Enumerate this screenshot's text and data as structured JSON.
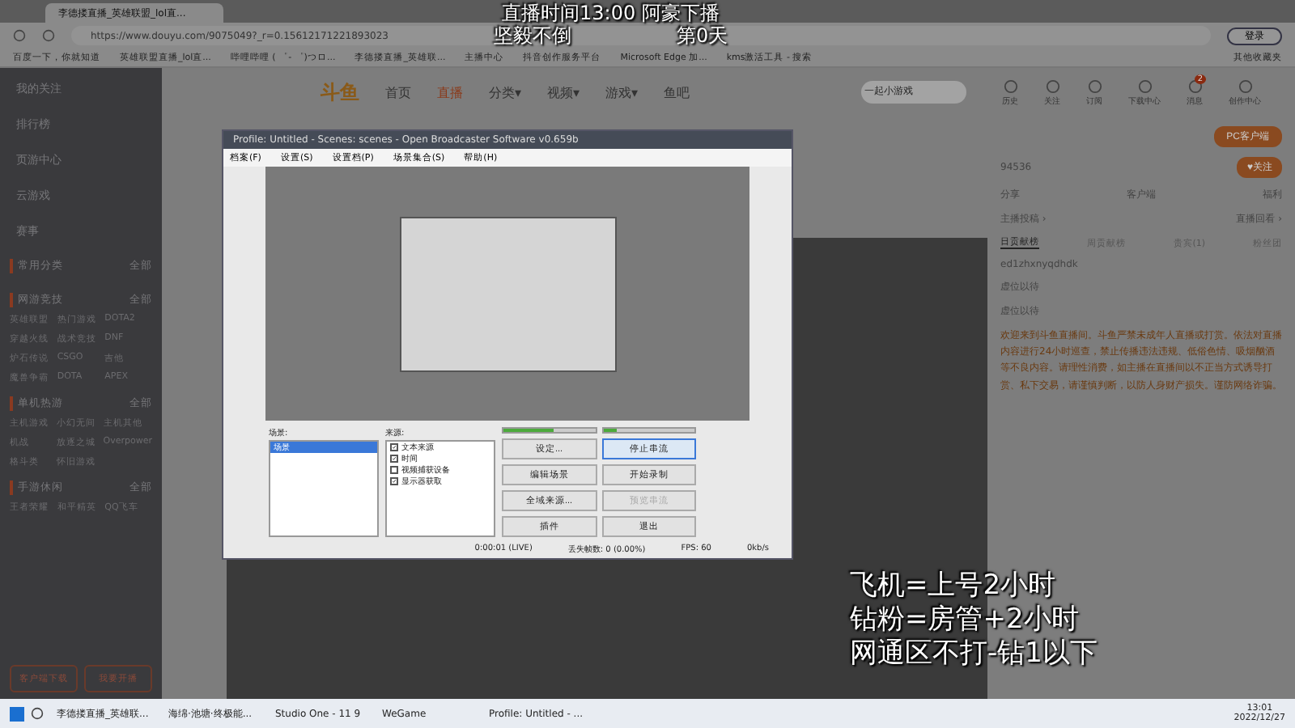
{
  "browser": {
    "tab_title": "李德搂直播_英雄联盟_lol直...",
    "address": "https://www.douyu.com/9075049?_r=0.15612171221893023",
    "login": "登录",
    "bookmarks": [
      "百度一下，你就知道",
      "英雄联盟直播_lol直...",
      "哔哩哔哩 ( ゜- ゜)つロ...",
      "李德搂直播_英雄联...",
      "主播中心",
      "抖音创作服务平台",
      "Microsoft Edge 加...",
      "kms激活工具 - 搜索"
    ],
    "other_bookmarks": "其他收藏夹"
  },
  "site": {
    "logo": "斗鱼",
    "nav": [
      {
        "label": "首页",
        "selected": false
      },
      {
        "label": "直播",
        "selected": true
      },
      {
        "label": "分类▾",
        "selected": false
      },
      {
        "label": "视频▾",
        "selected": false
      },
      {
        "label": "游戏▾",
        "selected": false
      },
      {
        "label": "鱼吧",
        "selected": false
      }
    ],
    "search": {
      "placeholder": "一起小游戏"
    },
    "header_icons": [
      "历史",
      "关注",
      "订阅",
      "下载中心",
      "消息",
      "创作中心"
    ],
    "message_badge": "2"
  },
  "sidebar": {
    "items": [
      "我的关注",
      "排行榜",
      "页游中心",
      "云游戏",
      "赛事"
    ],
    "sections": [
      {
        "title": "常用分类",
        "more": "全部"
      },
      {
        "title": "网游竞技",
        "more": "全部",
        "entries": [
          "英雄联盟",
          "热门游戏",
          "DOTA2",
          "穿越火线",
          "战术竞技",
          "DNF",
          "炉石传说",
          "CSGO",
          "吉他",
          "魔兽争霸",
          "DOTA",
          "APEX"
        ]
      },
      {
        "title": "单机热游",
        "more": "全部",
        "entries": [
          "主机游戏",
          "小幻无间",
          "主机其他",
          "机战",
          "放逐之城",
          "Overpower",
          "格斗类",
          "怀旧游戏"
        ]
      },
      {
        "title": "手游休闲",
        "more": "全部",
        "entries": [
          "王者荣耀",
          "和平精英",
          "QQ飞车"
        ]
      }
    ],
    "buttons": [
      "客户端下载",
      "我要开播"
    ]
  },
  "right_panel": {
    "pc_client": "PC客户端",
    "follow_count": "94536",
    "follow": "♥关注",
    "share": [
      "分享",
      "客户端",
      "福利"
    ],
    "links": [
      "主播投稿 ›",
      "直播回看 ›"
    ],
    "tabs": [
      {
        "label": "日贡献榜",
        "selected": true
      },
      {
        "label": "周贡献榜",
        "selected": false
      },
      {
        "label": "贵宾(1)",
        "selected": false
      },
      {
        "label": "粉丝团",
        "selected": false
      }
    ],
    "ranking": [
      "ed1zhxnyqdhdk",
      "虚位以待",
      "虚位以待"
    ],
    "notice": "欢迎来到斗鱼直播间。斗鱼严禁未成年人直播或打赏。依法对直播内容进行24小时巡查，禁止传播违法违规、低俗色情、吸烟酗酒等不良内容。请理性消费，如主播在直播间以不正当方式诱导打赏、私下交易，请谨慎判断，以防人身财产损失。谨防网络诈骗。"
  },
  "obs": {
    "title": "Profile: Untitled - Scenes: scenes - Open Broadcaster Software v0.659b",
    "menu": [
      "档案(F)",
      "设置(S)",
      "设置档(P)",
      "场景集合(S)",
      "帮助(H)"
    ],
    "scenes_label": "场景:",
    "scenes": [
      {
        "label": "场景",
        "selected": true
      }
    ],
    "sources_label": "来源:",
    "sources": [
      {
        "label": "文本来源",
        "checked": true
      },
      {
        "label": "时间",
        "checked": true
      },
      {
        "label": "视频捕获设备",
        "checked": false
      },
      {
        "label": "显示器获取",
        "checked": true
      }
    ],
    "buttons": [
      {
        "label": "设定...",
        "disabled": false,
        "highlighted": false
      },
      {
        "label": "停止串流",
        "disabled": false,
        "highlighted": true
      },
      {
        "label": "编辑场景",
        "disabled": false,
        "highlighted": false
      },
      {
        "label": "开始录制",
        "disabled": false,
        "highlighted": false
      },
      {
        "label": "全域来源...",
        "disabled": false,
        "highlighted": false
      },
      {
        "label": "预览串流",
        "disabled": true,
        "highlighted": false
      },
      {
        "label": "插件",
        "disabled": false,
        "highlighted": false
      },
      {
        "label": "退出",
        "disabled": false,
        "highlighted": false
      }
    ],
    "status": [
      "0:00:01 (LIVE)",
      "丢失帧数: 0 (0.00%)",
      "FPS: 60",
      "0kb/s"
    ],
    "mic": {
      "level": 0.55
    },
    "desktop": {
      "level": 0.15
    }
  },
  "overlay": {
    "top": "直播时间13:00 阿豪下播",
    "motto": "坚毅不倒",
    "days": "第0天",
    "rules": [
      "飞机=上号2小时",
      "钻粉=房管+2小时",
      "网通区不打-钻1以下"
    ]
  },
  "taskbar": {
    "apps": [
      "李德搂直播_英雄联...",
      "海绵·池塘·终极能...",
      "Studio One - 11 9",
      "WeGame",
      "Profile: Untitled - ..."
    ],
    "time": "13:01",
    "date": "2022/12/27"
  }
}
